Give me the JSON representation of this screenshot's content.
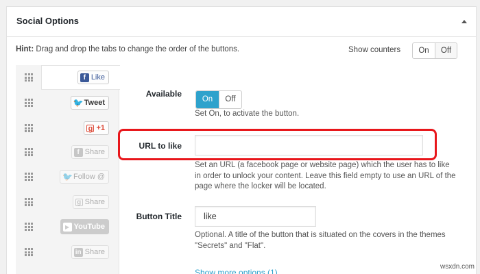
{
  "panel": {
    "title": "Social Options"
  },
  "hint": {
    "label": "Hint:",
    "text": " Drag and drop the tabs to change the order of the buttons.",
    "show_counters_label": "Show counters",
    "counters_on": "On",
    "counters_off": "Off"
  },
  "tabs": [
    {
      "label": "Like",
      "icon": "f"
    },
    {
      "label": "Tweet",
      "icon": "🐦"
    },
    {
      "label": "+1",
      "icon": "g"
    },
    {
      "label": "Share",
      "icon": "f"
    },
    {
      "label": "Follow @",
      "icon": "🐦"
    },
    {
      "label": "Share",
      "icon": "g"
    },
    {
      "label": "YouTube",
      "icon": "▶"
    },
    {
      "label": "Share",
      "icon": "in"
    }
  ],
  "form": {
    "available": {
      "label": "Available",
      "on": "On",
      "off": "Off",
      "help": "Set On, to activate the button."
    },
    "url": {
      "label": "URL to like",
      "value": "",
      "help": "Set an URL (a facebook page or website page) which the user has to like in order to unlock your content. Leave this field empty to use an URL of the page where the locker will be located."
    },
    "button_title": {
      "label": "Button Title",
      "value": "like",
      "help": "Optional. A title of the button that is situated on the covers in the themes \"Secrets\" and \"Flat\"."
    },
    "more_link": "Show more options (1)"
  },
  "colors": {
    "accent": "#2ea2cc",
    "highlight": "#e8161b",
    "facebook": "#3b5998",
    "twitter": "#55acee",
    "gplus": "#dd4b39"
  },
  "watermark": "wsxdn.com"
}
